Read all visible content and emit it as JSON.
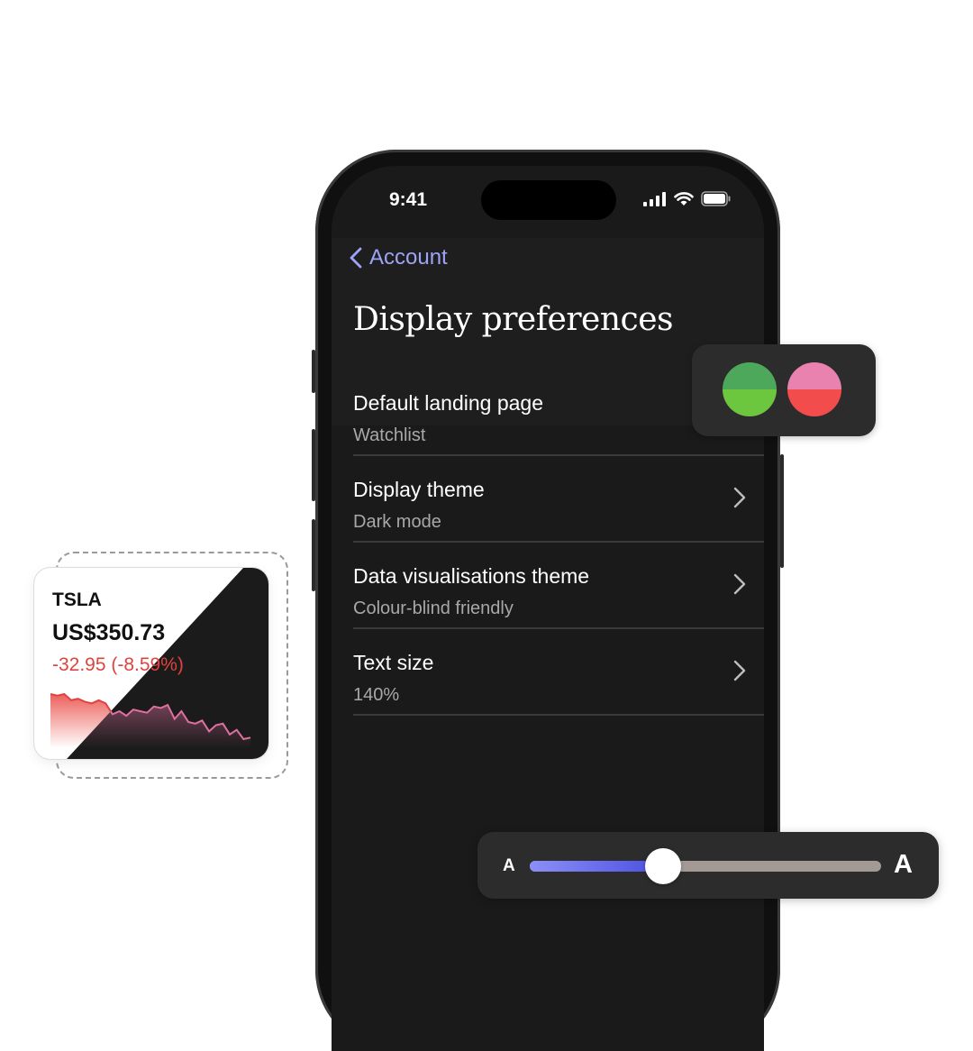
{
  "status_bar": {
    "time": "9:41"
  },
  "nav": {
    "back_label": "Account"
  },
  "page": {
    "title": "Display preferences"
  },
  "settings": [
    {
      "title": "Default landing page",
      "value": "Watchlist",
      "has_chevron": false
    },
    {
      "title": "Display theme",
      "value": "Dark mode",
      "has_chevron": true
    },
    {
      "title": "Data visualisations theme",
      "value": "Colour-blind friendly",
      "has_chevron": true
    },
    {
      "title": "Text size",
      "value": "140%",
      "has_chevron": true
    }
  ],
  "palette": {
    "swatches": [
      {
        "name": "green",
        "top": "#4ea85b",
        "bottom": "#6cc63e"
      },
      {
        "name": "pink-red",
        "top": "#ea82b0",
        "bottom": "#f24c4c"
      }
    ]
  },
  "stock": {
    "ticker": "TSLA",
    "price": "US$350.73",
    "change": "-32.95 (-8.59%)",
    "sparkline": [
      38,
      37,
      38,
      34,
      35,
      33,
      32,
      34,
      32,
      25,
      27,
      24,
      28,
      27,
      26,
      30,
      29,
      31,
      22,
      27,
      20,
      19,
      21,
      14,
      18,
      19,
      12,
      15,
      9,
      10
    ]
  },
  "text_size": {
    "small_label": "A",
    "large_label": "A",
    "level": 0.38
  },
  "colors": {
    "accent": "#9ea3f5",
    "negative": "#e0433f",
    "background_dark": "#1a1a1a"
  }
}
